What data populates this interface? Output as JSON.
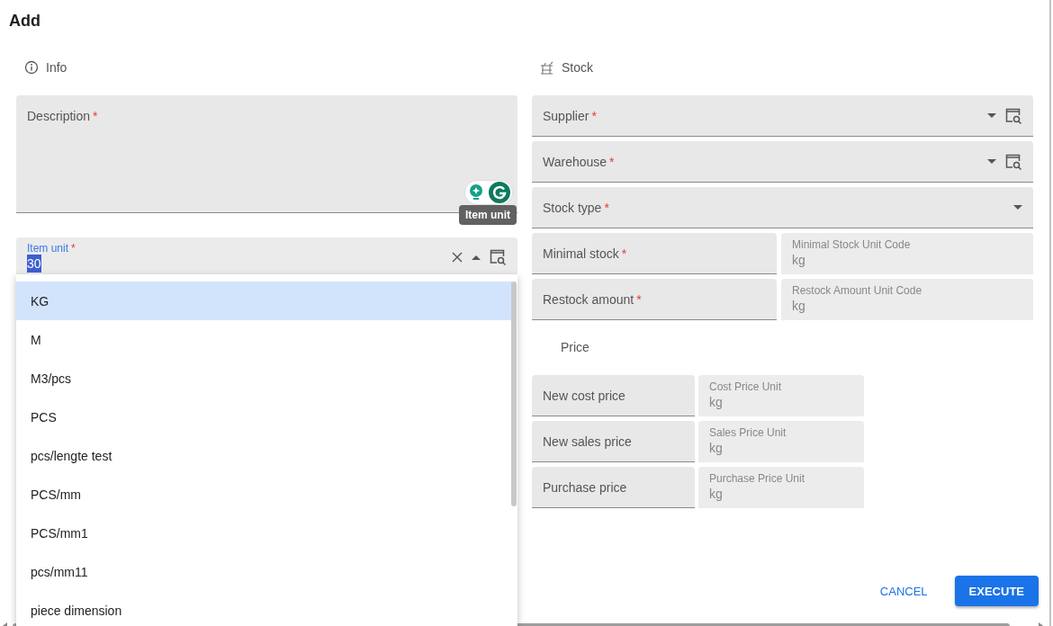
{
  "dialog": {
    "title": "Add",
    "required_marker": "*"
  },
  "info": {
    "heading": "Info",
    "description": {
      "label": "Description",
      "required": true
    },
    "item_unit": {
      "label": "Item unit",
      "required": true,
      "value": "30",
      "value_highlighted": true,
      "focused": true,
      "expanded": true
    },
    "options": [
      {
        "label": "KG",
        "selected": true
      },
      {
        "label": "M",
        "selected": false
      },
      {
        "label": "M3/pcs",
        "selected": false
      },
      {
        "label": "PCS",
        "selected": false
      },
      {
        "label": "pcs/lengte test",
        "selected": false
      },
      {
        "label": "PCS/mm",
        "selected": false
      },
      {
        "label": "PCS/mm1",
        "selected": false
      },
      {
        "label": "pcs/mm11",
        "selected": false
      },
      {
        "label": "piece dimension",
        "selected": false
      }
    ],
    "tooltip": "Item unit"
  },
  "stock": {
    "heading": "Stock",
    "fields": [
      {
        "label": "Supplier",
        "required": true,
        "kind": "lookup"
      },
      {
        "label": "Warehouse",
        "required": true,
        "kind": "lookup"
      },
      {
        "label": "Stock type",
        "required": true,
        "kind": "select"
      }
    ],
    "quantities": [
      {
        "label": "Minimal stock",
        "required": true,
        "unit_label": "Minimal Stock Unit Code",
        "unit_value": "kg"
      },
      {
        "label": "Restock amount",
        "required": true,
        "unit_label": "Restock Amount Unit Code",
        "unit_value": "kg"
      }
    ]
  },
  "price": {
    "heading": "Price",
    "rows": [
      {
        "label": "New cost price",
        "required": false,
        "unit_label": "Cost Price Unit",
        "unit_value": "kg"
      },
      {
        "label": "New sales price",
        "required": false,
        "unit_label": "Sales Price Unit",
        "unit_value": "kg"
      },
      {
        "label": "Purchase price",
        "required": false,
        "unit_label": "Purchase Price Unit",
        "unit_value": "kg"
      }
    ]
  },
  "buttons": [
    {
      "label": "CANCEL",
      "kind": "text"
    },
    {
      "label": "EXECUTE",
      "kind": "primary"
    }
  ]
}
